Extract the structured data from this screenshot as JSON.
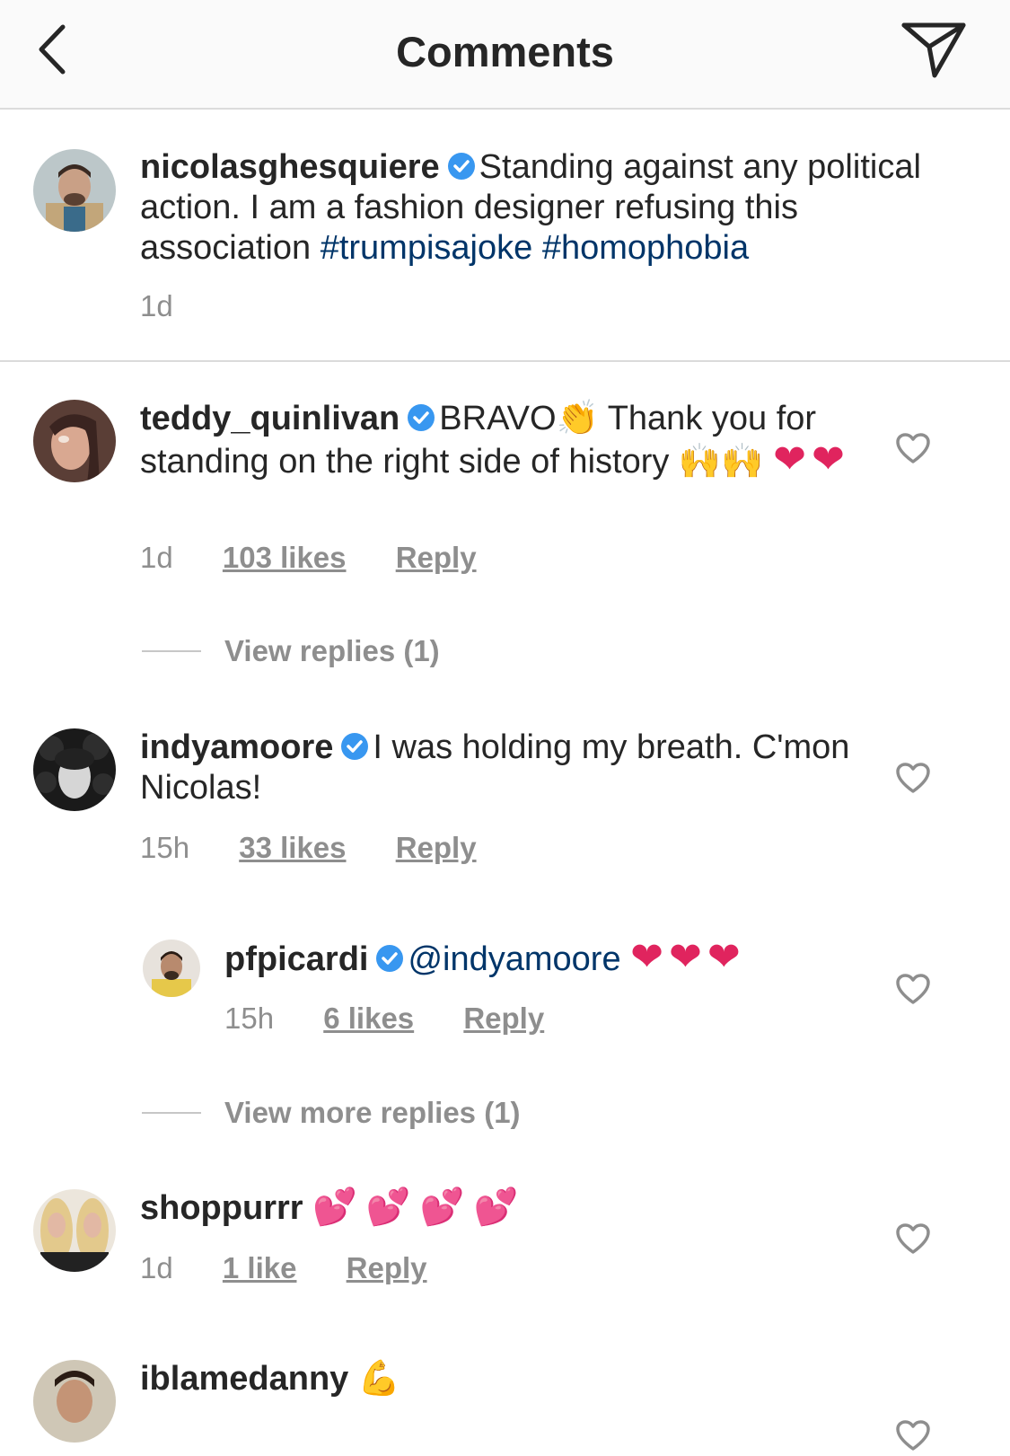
{
  "header": {
    "title": "Comments"
  },
  "post": {
    "username": "nicolasghesquiere",
    "text": "Standing against any political action. I am a fashion designer refusing this association",
    "hashtags": [
      "#trumpisajoke",
      "#homophobia"
    ],
    "time": "1d"
  },
  "comments": [
    {
      "username": "teddy_quinlivan",
      "text_a": "BRAVO",
      "emoji_a": "👏",
      "text_b": "Thank you for standing on the right side of history",
      "emoji_b": "🙌🙌",
      "emoji_c": "❤❤",
      "time": "1d",
      "likes": "103 likes",
      "reply_label": "Reply",
      "view_replies": "View replies (1)"
    },
    {
      "username": "indyamoore",
      "text": "I was holding my breath. C'mon Nicolas!",
      "time": "15h",
      "likes": "33 likes",
      "reply_label": "Reply",
      "reply": {
        "username": "pfpicardi",
        "mention": "@indyamoore",
        "emoji": "❤❤❤",
        "time": "15h",
        "likes": "6 likes",
        "reply_label": "Reply"
      },
      "view_more_replies": "View more replies (1)"
    },
    {
      "username": "shoppurrr",
      "emoji": "💕💕💕💕",
      "time": "1d",
      "likes": "1 like",
      "reply_label": "Reply"
    },
    {
      "username": "iblamedanny",
      "emoji": "💪"
    }
  ],
  "icons": {
    "back": "chevron-left-icon",
    "share": "paper-plane-icon",
    "verified": "verified-badge-icon",
    "like": "heart-outline-icon"
  },
  "colors": {
    "verified": "#3897f0",
    "hashtag": "#003569",
    "meta": "#8e8e8e",
    "heart_emoji": "#e0245e"
  }
}
